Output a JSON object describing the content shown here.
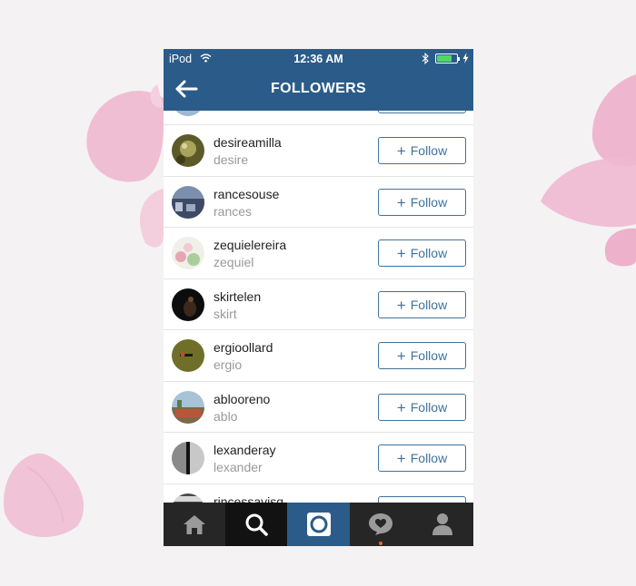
{
  "status_bar": {
    "carrier": "iPod",
    "time": "12:36 AM",
    "battery_level": 0.75
  },
  "nav": {
    "title": "FOLLOWERS"
  },
  "followers": [
    {
      "username": "desireamilla",
      "fullname": "desire",
      "button": "Follow"
    },
    {
      "username": "rancesouse",
      "fullname": "rances",
      "button": "Follow"
    },
    {
      "username": "zequielereira",
      "fullname": "zequiel",
      "button": "Follow"
    },
    {
      "username": "skirtelen",
      "fullname": "skirt",
      "button": "Follow"
    },
    {
      "username": "ergioollard",
      "fullname": "ergio",
      "button": "Follow"
    },
    {
      "username": "ablooreno",
      "fullname": "ablo",
      "button": "Follow"
    },
    {
      "username": "lexanderay",
      "fullname": "lexander",
      "button": "Follow"
    },
    {
      "username": "rincessavisq",
      "fullname": "",
      "button": ""
    }
  ],
  "tab_bar": {
    "tabs": [
      {
        "icon": "home-icon"
      },
      {
        "icon": "search-icon",
        "active": true
      },
      {
        "icon": "camera-icon"
      },
      {
        "icon": "activity-icon",
        "notification": true
      },
      {
        "icon": "profile-icon"
      }
    ]
  },
  "colors": {
    "brand": "#2b5c89",
    "follow": "#3f729b",
    "tab_bar": "#262626",
    "notification_dot": "#f26522"
  }
}
